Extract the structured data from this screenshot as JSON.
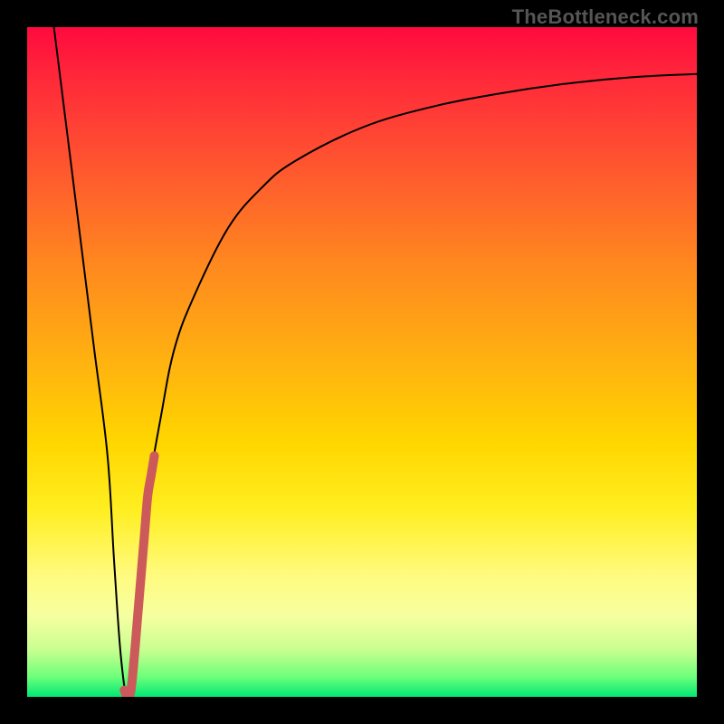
{
  "watermark": {
    "text": "TheBottleneck.com"
  },
  "chart_data": {
    "type": "line",
    "title": "",
    "xlabel": "",
    "ylabel": "",
    "xlim": [
      0,
      100
    ],
    "ylim": [
      0,
      100
    ],
    "background_gradient": {
      "direction": "vertical",
      "stops": [
        {
          "pos": 0.0,
          "color": "#ff0a3e"
        },
        {
          "pos": 0.5,
          "color": "#ffb210"
        },
        {
          "pos": 0.82,
          "color": "#fffb80"
        },
        {
          "pos": 1.0,
          "color": "#00e874"
        }
      ]
    },
    "series": [
      {
        "name": "bottleneck-curve",
        "color": "#000000",
        "stroke_width": 2,
        "x": [
          4,
          6,
          8,
          10,
          12,
          13,
          14,
          15,
          16,
          17,
          18,
          20,
          22,
          25,
          30,
          35,
          40,
          50,
          60,
          70,
          80,
          90,
          100
        ],
        "y": [
          100,
          84,
          68,
          52,
          36,
          20,
          6,
          0,
          6,
          18,
          30,
          42,
          52,
          60,
          70,
          76,
          80,
          85,
          88,
          90,
          91.5,
          92.5,
          93
        ]
      },
      {
        "name": "highlight-segment",
        "color": "#cc5a5a",
        "stroke_width": 10,
        "x": [
          14.5,
          15,
          15.5,
          16,
          16.5,
          17,
          17.5,
          18,
          18.5,
          19
        ],
        "y": [
          1,
          0,
          1,
          6,
          12,
          18,
          24,
          30,
          33,
          36
        ]
      }
    ]
  }
}
